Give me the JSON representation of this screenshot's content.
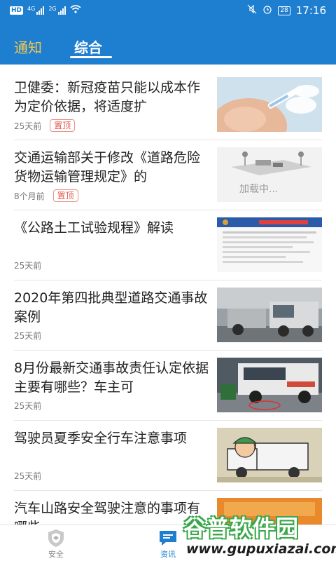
{
  "status_bar": {
    "left": {
      "hd": "HD",
      "sig1": "4G",
      "sig2": "2G"
    },
    "right": {
      "battery": "28",
      "time": "17:16"
    }
  },
  "tabs": [
    {
      "label": "通知",
      "active": false
    },
    {
      "label": "综合",
      "active": true
    }
  ],
  "feed": [
    {
      "title": "卫健委：新冠疫苗只能以成本作为定价依据，将适度扩",
      "time": "25天前",
      "badge": "置顶",
      "thumb": "vaccine-photo"
    },
    {
      "title": "交通运输部关于修改《道路危险货物运输管理规定》的",
      "time": "8个月前",
      "badge": "置顶",
      "thumb": "loading-placeholder",
      "thumb_text": "加载中..."
    },
    {
      "title": "《公路土工试验规程》解读",
      "time": "25天前",
      "badge": "",
      "thumb": "document-photo"
    },
    {
      "title": "2020年第四批典型道路交通事故案例",
      "time": "25天前",
      "badge": "",
      "thumb": "truck-accident-photo"
    },
    {
      "title": "8月份最新交通事故责任认定依据主要有哪些？车主可",
      "time": "25天前",
      "badge": "",
      "thumb": "bus-accident-photo"
    },
    {
      "title": "驾驶员夏季安全行车注意事项",
      "time": "25天前",
      "badge": "",
      "thumb": "driver-cartoon"
    },
    {
      "title": "汽车山路安全驾驶注意的事项有哪些",
      "time": "",
      "badge": "",
      "thumb": "orange-banner"
    }
  ],
  "bottom_nav": [
    {
      "label": "安全",
      "icon": "shield-icon",
      "active": false
    },
    {
      "label": "资讯",
      "icon": "chat-icon",
      "active": true
    }
  ],
  "watermark": {
    "title": "谷普软件园",
    "url": "www.gupuxiazai.com"
  },
  "colors": {
    "primary": "#1e7ed0",
    "accent": "#f6c84a",
    "badge": "#e05a4e"
  }
}
